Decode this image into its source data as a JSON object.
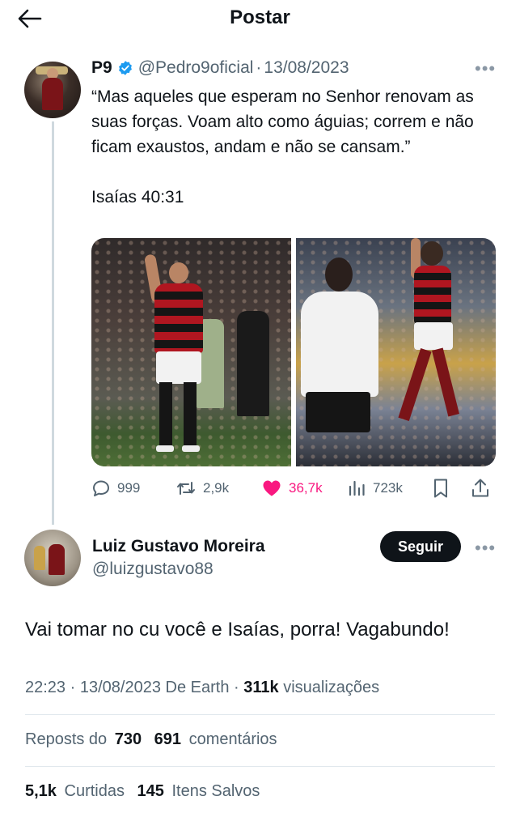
{
  "header": {
    "title": "Postar",
    "back_icon": "arrow-left-icon"
  },
  "tweet": {
    "name": "P9",
    "handle": "@Pedro9oficial",
    "separator": "·",
    "date": "13/08/2023",
    "verified_color": "#1d9bf0",
    "text": "“Mas aqueles que esperam no Senhor renovam as suas forças. Voam alto como águias; correm e não ficam exaustos, andam e não se cansam.”\n\nIsaías 40:31",
    "media": [
      {
        "icon": "photo-player-celebrating"
      },
      {
        "icon": "photo-player-jumping"
      }
    ],
    "actions": {
      "replies": "999",
      "reposts": "2,9k",
      "likes": "36,7k",
      "views": "723k",
      "like_color": "#f91880"
    }
  },
  "reply": {
    "name": "Luiz Gustavo Moreira",
    "handle": "@luizgustavo88",
    "follow_label": "Seguir",
    "text": "Vai tomar no cu você e Isaías, porra! Vagabundo!",
    "time": "22:23",
    "date": "13/08/2023",
    "source": "De Earth",
    "separator": "·",
    "views_count": "311k",
    "views_label": "visualizações",
    "reposts_label": "Reposts do",
    "reposts_count": "730",
    "comments_count": "691",
    "comments_label": "comentários",
    "likes_count": "5,1k",
    "likes_label": "Curtidas",
    "saved_count": "145",
    "saved_label": "Itens Salvos"
  }
}
